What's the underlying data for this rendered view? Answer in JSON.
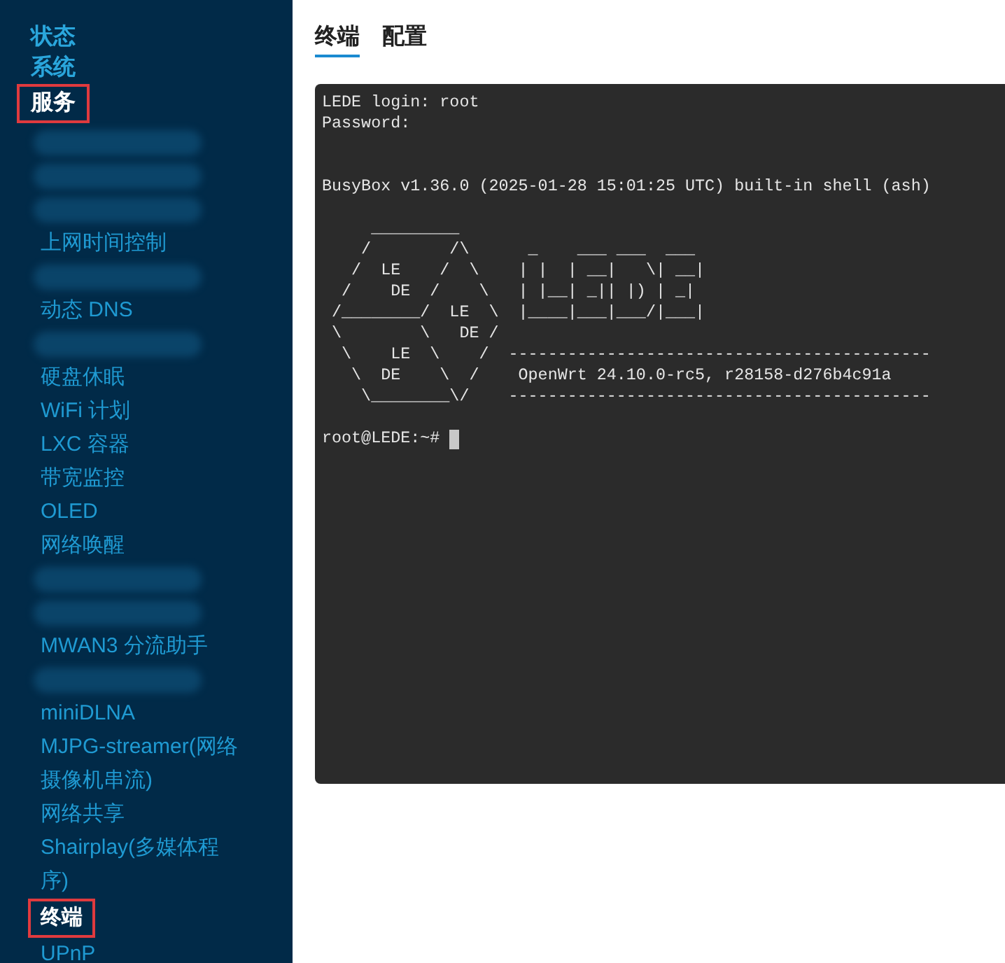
{
  "sidebar": {
    "sections": [
      {
        "label": "状态",
        "selected": false,
        "highlighted": false
      },
      {
        "label": "系统",
        "selected": false,
        "highlighted": false
      },
      {
        "label": "服务",
        "selected": true,
        "highlighted": true
      }
    ],
    "items": [
      {
        "kind": "redacted"
      },
      {
        "kind": "redacted"
      },
      {
        "kind": "redacted"
      },
      {
        "kind": "link",
        "label": "上网时间控制",
        "selected": false,
        "highlighted": false
      },
      {
        "kind": "redacted"
      },
      {
        "kind": "link",
        "label": "动态 DNS",
        "selected": false,
        "highlighted": false
      },
      {
        "kind": "redacted"
      },
      {
        "kind": "link",
        "label": "硬盘休眠",
        "selected": false,
        "highlighted": false
      },
      {
        "kind": "link",
        "label": "WiFi 计划",
        "selected": false,
        "highlighted": false
      },
      {
        "kind": "link",
        "label": "LXC 容器",
        "selected": false,
        "highlighted": false
      },
      {
        "kind": "link",
        "label": "带宽监控",
        "selected": false,
        "highlighted": false
      },
      {
        "kind": "link",
        "label": "OLED",
        "selected": false,
        "highlighted": false
      },
      {
        "kind": "link",
        "label": "网络唤醒",
        "selected": false,
        "highlighted": false
      },
      {
        "kind": "redacted"
      },
      {
        "kind": "redacted"
      },
      {
        "kind": "link",
        "label": "MWAN3 分流助手",
        "selected": false,
        "highlighted": false
      },
      {
        "kind": "redacted"
      },
      {
        "kind": "link",
        "label": "miniDLNA",
        "selected": false,
        "highlighted": false
      },
      {
        "kind": "link",
        "label": "MJPG-streamer(网络摄像机串流)",
        "selected": false,
        "highlighted": false
      },
      {
        "kind": "link",
        "label": "网络共享",
        "selected": false,
        "highlighted": false
      },
      {
        "kind": "link",
        "label": "Shairplay(多媒体程序)",
        "selected": false,
        "highlighted": false
      },
      {
        "kind": "link",
        "label": "终端",
        "selected": true,
        "highlighted": true
      },
      {
        "kind": "link",
        "label": "UPnP",
        "selected": false,
        "highlighted": false
      }
    ]
  },
  "tabs": [
    {
      "label": "终端",
      "selected": true
    },
    {
      "label": "配置",
      "selected": false
    }
  ],
  "terminal": {
    "blocks": [
      {
        "kind": "login",
        "lines": [
          "LEDE login: root",
          "Password:"
        ]
      },
      {
        "kind": "output",
        "lines": [
          "BusyBox v1.36.0 (2025-01-28 15:01:25 UTC) built-in shell (ash)"
        ]
      },
      {
        "kind": "output",
        "lines": [
          "     _________",
          "    /        /\\      _    ___ ___  ___",
          "   /  LE    /  \\    | |  | __|   \\| __|",
          "  /    DE  /    \\   | |__| _|| |) | _|",
          " /________/  LE  \\  |____|___|___/|___|",
          " \\        \\   DE /",
          "  \\    LE  \\    /  -------------------------------------------",
          "   \\  DE    \\  /    OpenWrt 24.10.0-rc5, r28158-d276b4c91a",
          "    \\________\\/    -------------------------------------------"
        ]
      }
    ],
    "prompt": "root@LEDE:~#",
    "cursor": true
  }
}
